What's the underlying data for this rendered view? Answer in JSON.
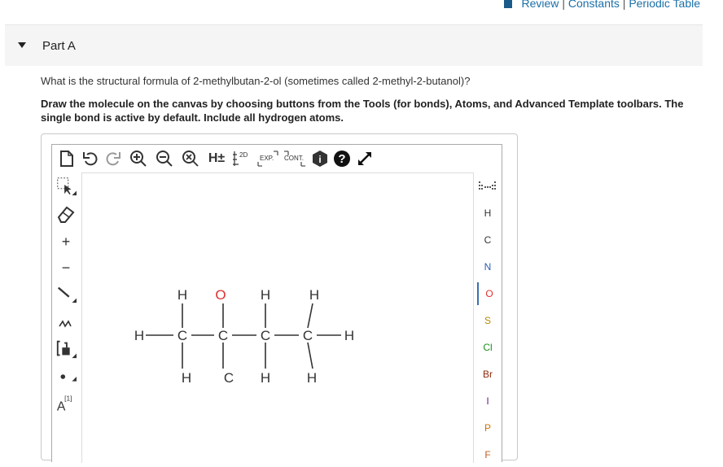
{
  "top_links": {
    "review": "Review",
    "constants": "Constants",
    "periodic_table": "Periodic Table",
    "sep": "|"
  },
  "part": {
    "title": "Part A"
  },
  "question": "What is the structural formula of 2-methylbutan-2-ol (sometimes called 2-methyl-2-butanol)?",
  "instructions": "Draw the molecule on the canvas by choosing buttons from the Tools (for bonds), Atoms, and Advanced Template toolbars. The single bond is active by default. Include all hydrogen atoms.",
  "toolbar": {
    "h_toggle": "H±",
    "layout_2d": "2D",
    "expand": "EXP.",
    "contract": "CONT.",
    "info": "i",
    "help": "?"
  },
  "left_tools": {
    "plus": "+",
    "minus": "−",
    "label": "A",
    "label_sup": "[1]"
  },
  "atoms": [
    "H",
    "C",
    "N",
    "O",
    "S",
    "Cl",
    "Br",
    "I",
    "P",
    "F"
  ],
  "active_atom": "O",
  "colors": {
    "link": "#1a6fa8",
    "oxygen": "#e03030",
    "nitrogen": "#2a5db0",
    "sulfur": "#b08a00",
    "chlorine": "#1a8f1a",
    "phosphorus": "#d07000",
    "active_border": "#3a6fb0"
  },
  "molecule": {
    "labels": {
      "h_left": "H",
      "h_right": "H",
      "c1": "C",
      "c2": "C",
      "c3": "C",
      "c4": "C",
      "top1": "H",
      "top2": "O",
      "top3": "H",
      "top4": "H",
      "bot1": "H",
      "bot2": "C",
      "bot3": "H",
      "bot4": "H"
    }
  }
}
